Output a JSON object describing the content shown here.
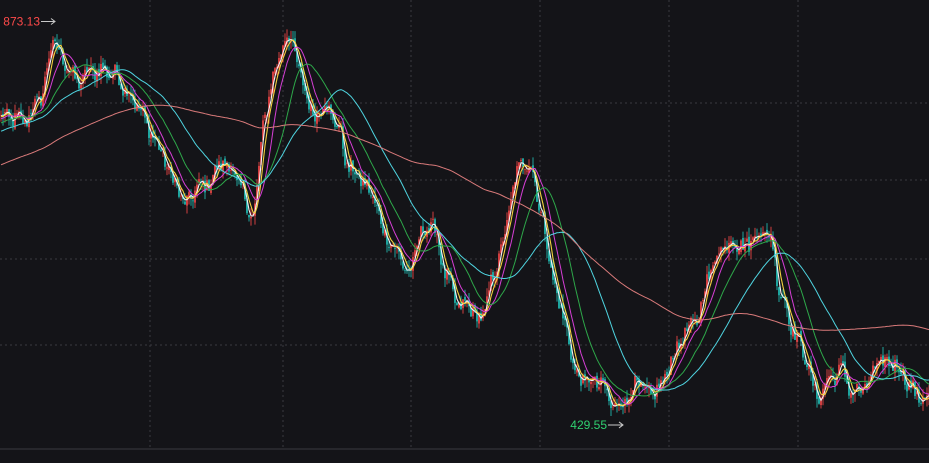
{
  "chart_data": {
    "type": "candlestick",
    "ylim": [
      413,
      888
    ],
    "grid": true,
    "annotations": {
      "high": {
        "value": "873.13",
        "x_index": 27,
        "color": "#ff4a4a"
      },
      "low": {
        "value": "429.55",
        "x_index": 311,
        "color": "#2fd170"
      }
    },
    "colors": {
      "up": "#ff4a4a",
      "down": "#22c8c0",
      "ma_fast": "#f4f4f4",
      "ma_yellow": "#f4d03f",
      "ma_magenta": "#d63fd6",
      "ma_green": "#2ea84a",
      "ma_cyan": "#4fd4e0",
      "ma_pink": "#d97a7a",
      "grid": "#3a3a40",
      "background": "#141418"
    },
    "close_anchors": [
      [
        0,
        768
      ],
      [
        12,
        765
      ],
      [
        20,
        790
      ],
      [
        26,
        850
      ],
      [
        33,
        825
      ],
      [
        38,
        805
      ],
      [
        44,
        818
      ],
      [
        50,
        820
      ],
      [
        57,
        815
      ],
      [
        62,
        800
      ],
      [
        68,
        782
      ],
      [
        74,
        755
      ],
      [
        80,
        730
      ],
      [
        86,
        700
      ],
      [
        92,
        672
      ],
      [
        98,
        690
      ],
      [
        104,
        696
      ],
      [
        110,
        718
      ],
      [
        115,
        712
      ],
      [
        120,
        688
      ],
      [
        126,
        658
      ],
      [
        132,
        770
      ],
      [
        138,
        830
      ],
      [
        144,
        860
      ],
      [
        150,
        812
      ],
      [
        156,
        770
      ],
      [
        162,
        782
      ],
      [
        168,
        760
      ],
      [
        174,
        712
      ],
      [
        180,
        700
      ],
      [
        186,
        680
      ],
      [
        192,
        640
      ],
      [
        198,
        620
      ],
      [
        204,
        596
      ],
      [
        210,
        640
      ],
      [
        216,
        650
      ],
      [
        222,
        598
      ],
      [
        228,
        562
      ],
      [
        234,
        560
      ],
      [
        240,
        545
      ],
      [
        246,
        590
      ],
      [
        252,
        640
      ],
      [
        258,
        710
      ],
      [
        264,
        720
      ],
      [
        270,
        665
      ],
      [
        276,
        590
      ],
      [
        282,
        540
      ],
      [
        288,
        482
      ],
      [
        294,
        478
      ],
      [
        300,
        475
      ],
      [
        306,
        450
      ],
      [
        312,
        456
      ],
      [
        318,
        475
      ],
      [
        324,
        462
      ],
      [
        330,
        472
      ],
      [
        336,
        505
      ],
      [
        342,
        530
      ],
      [
        348,
        545
      ],
      [
        354,
        595
      ],
      [
        360,
        625
      ],
      [
        366,
        632
      ],
      [
        372,
        625
      ],
      [
        378,
        640
      ],
      [
        384,
        640
      ],
      [
        390,
        575
      ],
      [
        396,
        535
      ],
      [
        402,
        505
      ],
      [
        408,
        460
      ],
      [
        414,
        480
      ],
      [
        420,
        490
      ],
      [
        426,
        465
      ],
      [
        432,
        470
      ],
      [
        438,
        495
      ],
      [
        444,
        500
      ],
      [
        450,
        490
      ],
      [
        455,
        470
      ],
      [
        459,
        460
      ]
    ],
    "moving_averages": [
      {
        "color": "#f4f4f4",
        "period": 3
      },
      {
        "color": "#f4d03f",
        "period": 5
      },
      {
        "color": "#d63fd6",
        "period": 10
      },
      {
        "color": "#2ea84a",
        "period": 20
      },
      {
        "color": "#4fd4e0",
        "period": 40
      },
      {
        "color": "#d97a7a",
        "period": 120
      }
    ]
  }
}
